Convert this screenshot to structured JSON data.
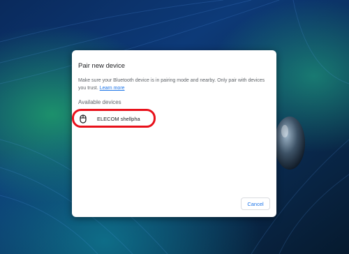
{
  "dialog": {
    "title": "Pair new device",
    "description": "Make sure your Bluetooth device is in pairing mode and nearby. Only pair with devices you trust.",
    "learn_more": "Learn more",
    "section_label": "Available devices",
    "devices": [
      {
        "name": "ELECOM shellpha",
        "icon": "mouse-icon"
      }
    ],
    "cancel_label": "Cancel"
  },
  "colors": {
    "accent": "#1a73e8",
    "highlight": "#e8101a",
    "title_text": "#202124",
    "secondary_text": "#5f6368",
    "dialog_bg": "#ffffff"
  }
}
